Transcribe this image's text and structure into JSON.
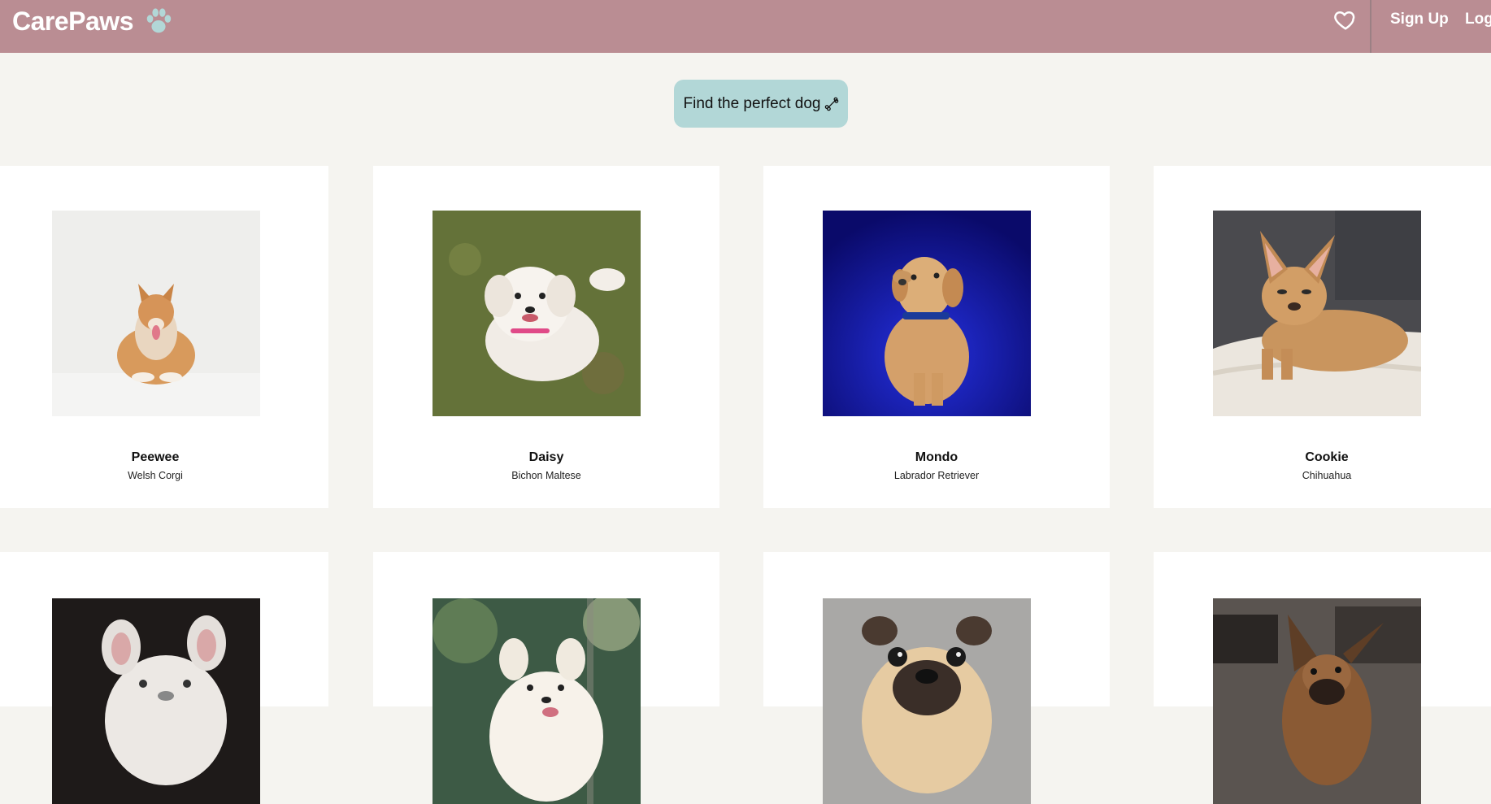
{
  "header": {
    "brand": "CarePaws",
    "brand_icon": "paw-icon",
    "favorites_icon": "heart-icon",
    "signup_label": "Sign Up",
    "login_label": "Log"
  },
  "hero": {
    "button_label": "Find the perfect dog",
    "button_icon": "bone-icon"
  },
  "colors": {
    "navbar": "#ba8d93",
    "accent": "#b2d7d7",
    "background": "#f5f4f0",
    "card": "#ffffff"
  },
  "dogs": [
    {
      "name": "Peewee",
      "breed": "Welsh Corgi"
    },
    {
      "name": "Daisy",
      "breed": "Bichon Maltese"
    },
    {
      "name": "Mondo",
      "breed": "Labrador Retriever"
    },
    {
      "name": "Cookie",
      "breed": "Chihuahua"
    },
    {
      "name": "",
      "breed": ""
    },
    {
      "name": "",
      "breed": ""
    },
    {
      "name": "",
      "breed": ""
    },
    {
      "name": "",
      "breed": ""
    }
  ]
}
